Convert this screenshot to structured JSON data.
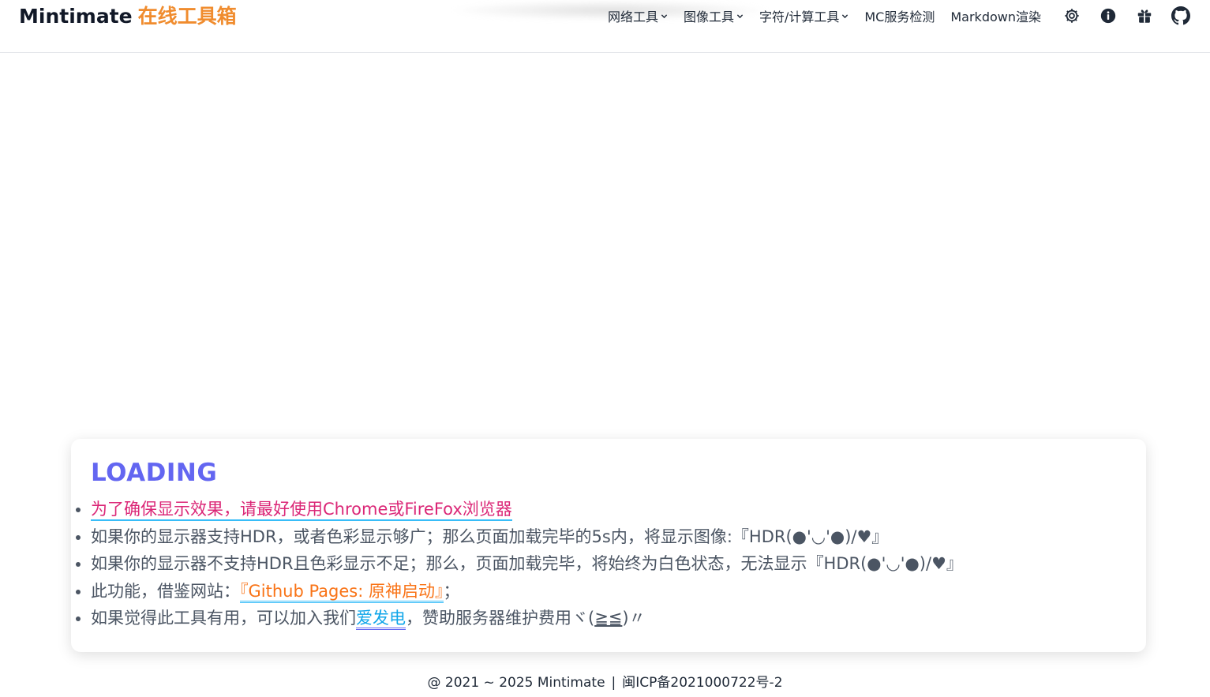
{
  "header": {
    "brand_name": "Mintimate",
    "brand_accent": "在线工具箱",
    "nav": [
      {
        "label": "网络工具",
        "dropdown": true
      },
      {
        "label": "图像工具",
        "dropdown": true
      },
      {
        "label": "字符/计算工具",
        "dropdown": true
      },
      {
        "label": "MC服务检测",
        "dropdown": false
      },
      {
        "label": "Markdown渲染",
        "dropdown": false
      }
    ],
    "icons": [
      "gear-icon",
      "info-icon",
      "gift-icon",
      "github-icon"
    ]
  },
  "card": {
    "title": "LOADING",
    "item1_link": "为了确保显示效果，请最好使用Chrome或FireFox浏览器",
    "item2_text": "如果你的显示器支持HDR，或者色彩显示够广；那么页面加载完毕的5s内，将显示图像:『HDR(●'◡'●)/♥』",
    "item3_text": "如果你的显示器不支持HDR且色彩显示不足；那么，页面加载完毕，将始终为白色状态，无法显示『HDR(●'◡'●)/♥』",
    "item4_prefix": "此功能，借鉴网站：",
    "item4_link": "『Github Pages: 原神启动』",
    "item4_suffix": "；",
    "item5_prefix": "如果觉得此工具有用，可以加入我们",
    "item5_link": "爱发电",
    "item5_mid": "，赞助服务器维护费用ヾ(",
    "item5_face": "≧≦",
    "item5_end": ")〃"
  },
  "footer": {
    "copyright": "@ 2021 ~ 2025 Mintimate",
    "separator": "|",
    "icp": "闽ICP备2021000722号-2"
  },
  "colors": {
    "brand_accent": "#f08c2e",
    "title": "#6366f1",
    "pink_link": "#db2777",
    "orange_link": "#f97316",
    "blue_link": "#0ea5e9"
  }
}
